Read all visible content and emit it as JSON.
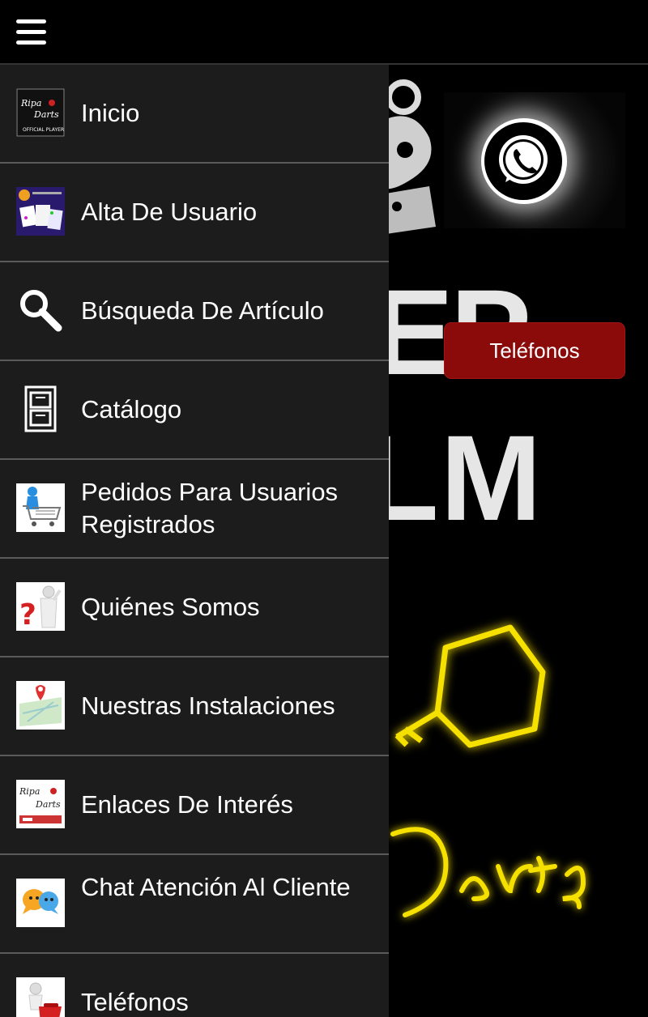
{
  "topbar": {
    "menu_icon": "hamburger-menu-icon"
  },
  "drawer": {
    "items": [
      {
        "label": "Inicio",
        "icon": "ripa-darts-logo-thumbnail"
      },
      {
        "label": "Alta De Usuario",
        "icon": "user-registration-thumbnail"
      },
      {
        "label": "Búsqueda De Artículo",
        "icon": "search-icon"
      },
      {
        "label": "Catálogo",
        "icon": "file-cabinet-icon"
      },
      {
        "label": "Pedidos Para Usuarios Registrados",
        "icon": "shopping-cart-thumbnail"
      },
      {
        "label": "Quiénes Somos",
        "icon": "question-person-thumbnail"
      },
      {
        "label": "Nuestras Instalaciones",
        "icon": "map-location-thumbnail"
      },
      {
        "label": "Enlaces De Interés",
        "icon": "ripa-darts-links-thumbnail"
      },
      {
        "label": "Chat Atención Al Cliente",
        "icon": "chat-bubbles-thumbnail"
      },
      {
        "label": "Teléfonos",
        "icon": "telephone-thumbnail"
      }
    ]
  },
  "background": {
    "telefonos_button": "Teléfonos",
    "whatsapp_icon": "whatsapp-icon",
    "colors": {
      "button_red": "#8b0a0a",
      "neon_yellow": "#f5e000",
      "drawer_bg": "#1c1c1c"
    }
  }
}
